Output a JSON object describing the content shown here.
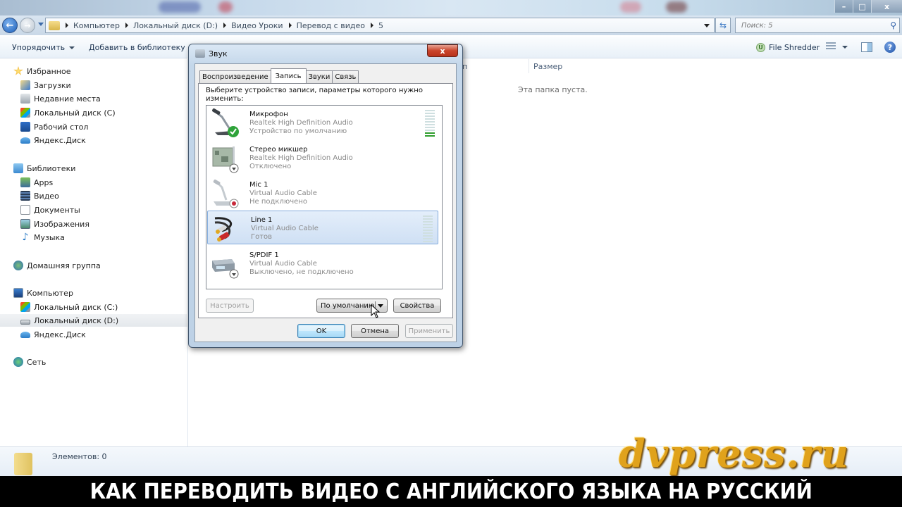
{
  "window": {
    "controls": {
      "minimize": "–",
      "maximize": "□",
      "close": "x"
    }
  },
  "nav": {
    "back_icon": "arrow-left-icon",
    "breadcrumb": [
      "Компьютер",
      "Локальный диск (D:)",
      "Видео Уроки",
      "Перевод с видео",
      "5"
    ],
    "search_placeholder": "Поиск: 5"
  },
  "toolbar": {
    "organize": "Упорядочить",
    "add_to_library": "Добавить в библиотеку",
    "file_shredder": "File Shredder"
  },
  "sidebar": {
    "favorites": {
      "label": "Избранное",
      "items": [
        "Загрузки",
        "Недавние места",
        "Локальный диск (C)",
        "Рабочий стол",
        "Яндекс.Диск"
      ]
    },
    "libraries": {
      "label": "Библиотеки",
      "items": [
        "Apps",
        "Видео",
        "Документы",
        "Изображения",
        "Музыка"
      ]
    },
    "homegroup": {
      "label": "Домашняя группа"
    },
    "computer": {
      "label": "Компьютер",
      "items": [
        "Локальный диск (C:)",
        "Локальный диск (D:)",
        "Яндекс.Диск"
      ],
      "selected": "Локальный диск (D:)"
    },
    "network": {
      "label": "Сеть"
    }
  },
  "content": {
    "column_size": "Размер",
    "column_truncated": "п",
    "empty_message": "Эта папка пуста."
  },
  "statusbar": {
    "items_count": "Элементов: 0"
  },
  "dialog": {
    "title": "Звук",
    "close": "x",
    "tabs": [
      {
        "label": "Воспроизведение",
        "active": false
      },
      {
        "label": "Запись",
        "active": true
      },
      {
        "label": "Звуки",
        "active": false
      },
      {
        "label": "Связь",
        "active": false
      }
    ],
    "instruction": "Выберите устройство записи, параметры которого нужно изменить:",
    "devices": [
      {
        "name": "Микрофон",
        "driver": "Realtek High Definition Audio",
        "status": "Устройство по умолчанию",
        "icon": "microphone-icon",
        "badge": "default-check",
        "level": 0.2,
        "selected": false
      },
      {
        "name": "Стерео микшер",
        "driver": "Realtek High Definition Audio",
        "status": "Отключено",
        "icon": "sound-card-icon",
        "badge": "disabled-arrow",
        "selected": false
      },
      {
        "name": "Mic 1",
        "driver": "Virtual Audio Cable",
        "status": "Не подключено",
        "icon": "microphone-icon",
        "badge": "unplugged",
        "selected": false
      },
      {
        "name": "Line 1",
        "driver": "Virtual Audio Cable",
        "status": "Готов",
        "icon": "rca-cable-icon",
        "level": 0,
        "selected": true
      },
      {
        "name": "S/PDIF 1",
        "driver": "Virtual Audio Cable",
        "status": "Выключено, не подключено",
        "icon": "spdif-device-icon",
        "badge": "disabled-arrow",
        "selected": false
      }
    ],
    "buttons": {
      "configure": "Настроить",
      "set_default": "По умолчанию",
      "properties": "Свойства",
      "ok": "OK",
      "cancel": "Отмена",
      "apply": "Применить"
    }
  },
  "overlay": {
    "watermark": "dvpress.ru",
    "banner": "КАК ПЕРЕВОДИТЬ ВИДЕО С АНГЛИЙСКОГО ЯЗЫКА НА РУССКИЙ"
  },
  "colors": {
    "selection_blue": "#cfe0f4",
    "meter_on": "#2e9d2c",
    "close_red": "#c9442b",
    "watermark_gold": "#e0a21c"
  }
}
